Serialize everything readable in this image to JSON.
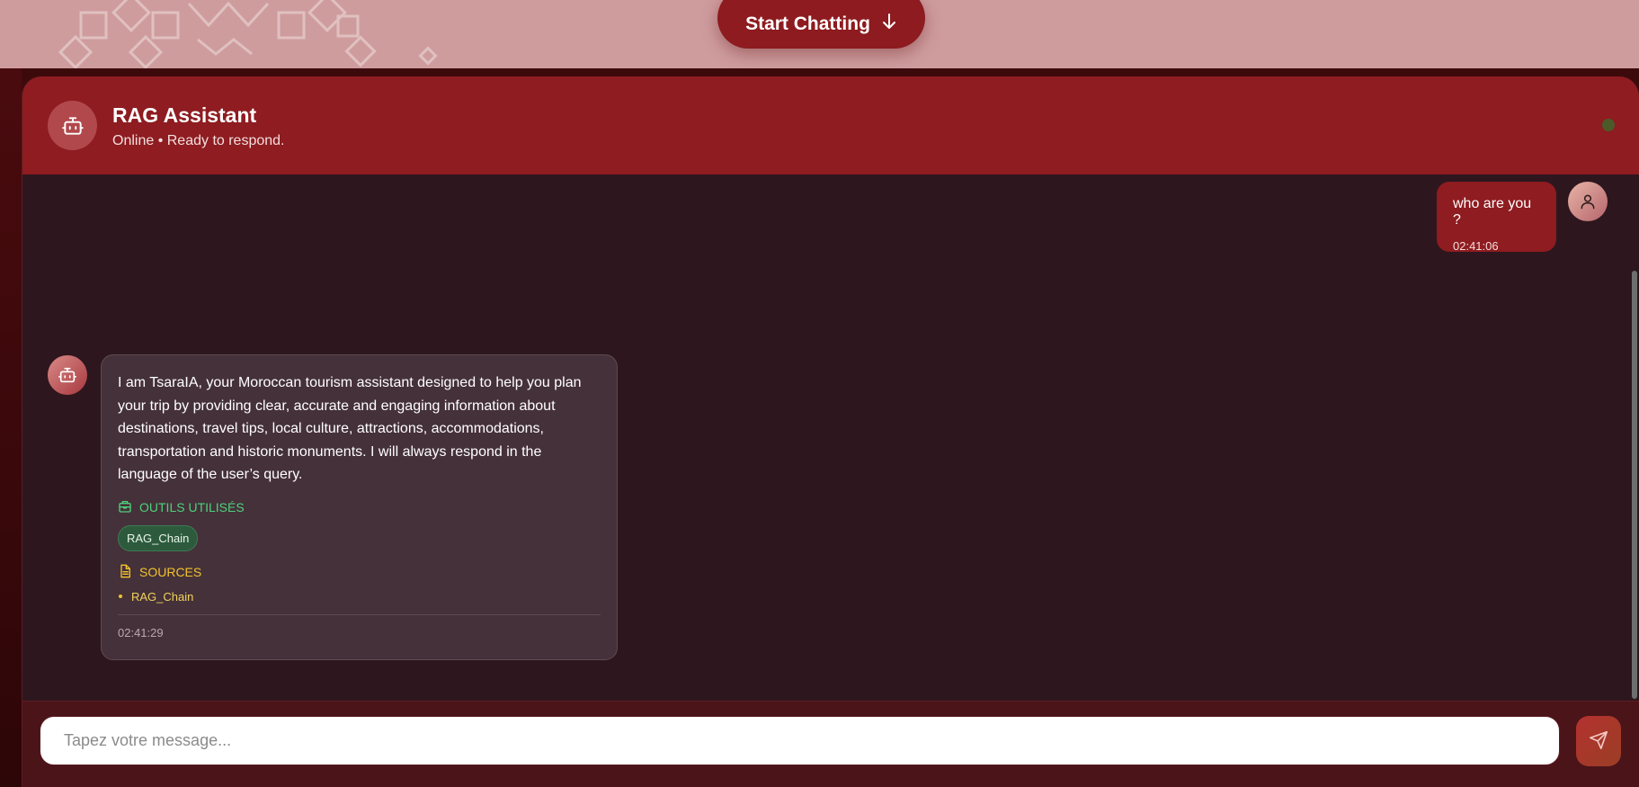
{
  "hero": {
    "start_label": "Start Chatting",
    "start_icon": "arrow-down-icon"
  },
  "header": {
    "title": "RAG Assistant",
    "status": "Online • Ready to respond.",
    "avatar_icon": "bot-icon",
    "status_color": "#4c5a2a"
  },
  "messages": {
    "user": {
      "text": "who are you ?",
      "time": "02:41:06",
      "avatar_icon": "user-icon"
    },
    "bot": {
      "text": "I am TsaraIA, your Moroccan tourism assistant designed to help you plan your trip by providing clear, accurate and engaging information about destinations, travel tips, local culture, attractions, accommodations, transportation and historic monuments. I will always respond in the language of the user’s query.",
      "tools_title": "OUTILS UTILISÉS",
      "tools": [
        "RAG_Chain"
      ],
      "sources_title": "SOURCES",
      "sources": [
        "RAG_Chain"
      ],
      "time": "02:41:29",
      "avatar_icon": "bot-icon"
    }
  },
  "composer": {
    "placeholder": "Tapez votre message...",
    "send_icon": "send-icon"
  },
  "colors": {
    "accent": "#8e1c20",
    "chat_bg": "#2e161e",
    "tools": "#4ed17c",
    "sources": "#f2c32b"
  }
}
